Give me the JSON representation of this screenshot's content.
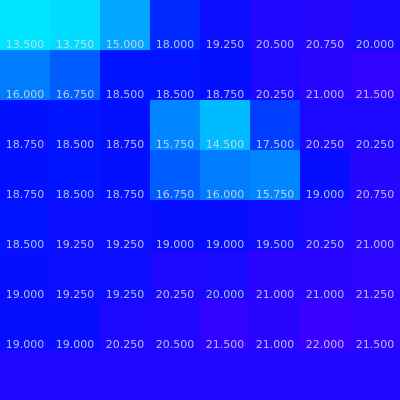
{
  "chart_data": {
    "type": "heatmap",
    "rows": 8,
    "cols": 8,
    "value_format_decimals": 3,
    "values": [
      [
        13.5,
        13.75,
        15.0,
        18.0,
        19.25,
        20.5,
        20.75,
        20.0
      ],
      [
        16.0,
        16.75,
        18.5,
        18.5,
        18.75,
        20.25,
        21.0,
        21.5
      ],
      [
        18.75,
        18.5,
        18.75,
        15.75,
        14.5,
        17.5,
        20.25,
        20.25
      ],
      [
        18.75,
        18.5,
        18.75,
        16.75,
        16.0,
        15.75,
        19.0,
        20.75
      ],
      [
        18.5,
        19.25,
        19.25,
        19.0,
        19.0,
        19.5,
        20.25,
        21.0
      ],
      [
        19.0,
        19.25,
        19.25,
        20.25,
        20.0,
        21.0,
        21.0,
        21.25
      ],
      [
        19.0,
        19.0,
        20.25,
        20.5,
        21.5,
        21.0,
        22.0,
        21.5
      ],
      [
        null,
        null,
        null,
        null,
        null,
        null,
        null,
        null
      ]
    ],
    "color_scale": {
      "low_value": 13.5,
      "high_value": 22.0,
      "low_color": "#00e5ff",
      "mid_color": "#0010ff",
      "high_color": "#3a00ff"
    },
    "title": "",
    "xlabel": "",
    "ylabel": ""
  }
}
